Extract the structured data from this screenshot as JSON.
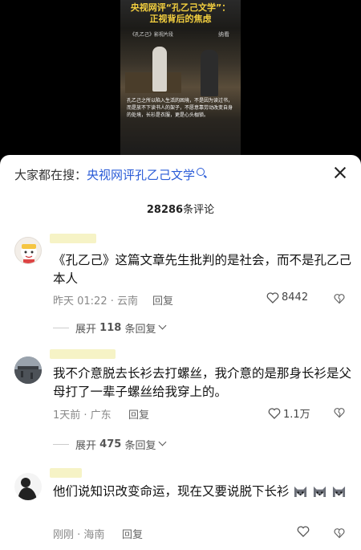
{
  "video": {
    "title_line1": "央视网评“孔乙己文学”：",
    "title_line2": "正视背后的焦虑",
    "source": "《孔乙己》影视片段",
    "watermark": "纳看",
    "subtitle": "孔乙己之所以陷入生活的困境，不是因为读过书，而是放不下读书人的架子，不愿意靠劳动改变自身的处境，长衫是衣服，更是心头枷锁。"
  },
  "panel": {
    "search_prefix": "大家都在搜：",
    "search_term": "央视网评孔乙己文学",
    "comment_count_number": "28286",
    "comment_count_suffix": "条评论"
  },
  "comments": [
    {
      "text": "《孔乙己》这篇文章先生批判的是社会，而不是孔乙己本人",
      "meta": "昨天 01:22 · 云南",
      "reply": "回复",
      "likes": "8442",
      "expand_prefix": "展开",
      "expand_count": "118",
      "expand_suffix": "条回复"
    },
    {
      "text": "我不介意脱去长衫去打螺丝，我介意的是那身长衫是父母打了一辈子螺丝给我穿上的。",
      "meta": "1天前 · 广东",
      "reply": "回复",
      "likes": "1.1万",
      "expand_prefix": "展开",
      "expand_count": "475",
      "expand_suffix": "条回复"
    },
    {
      "text": "他们说知识改变命运，现在又要说脱下长衫",
      "meta": "刚刚 · 海南",
      "reply": "回复",
      "likes": ""
    }
  ],
  "icons": {
    "close": "close-icon",
    "search": "search-icon",
    "like": "heart-icon",
    "dislike": "broken-heart-icon",
    "emoji": "husky-dog-emoji"
  },
  "colors": {
    "search_term": "#2a5bd7",
    "video_title": "#f4d03f"
  }
}
